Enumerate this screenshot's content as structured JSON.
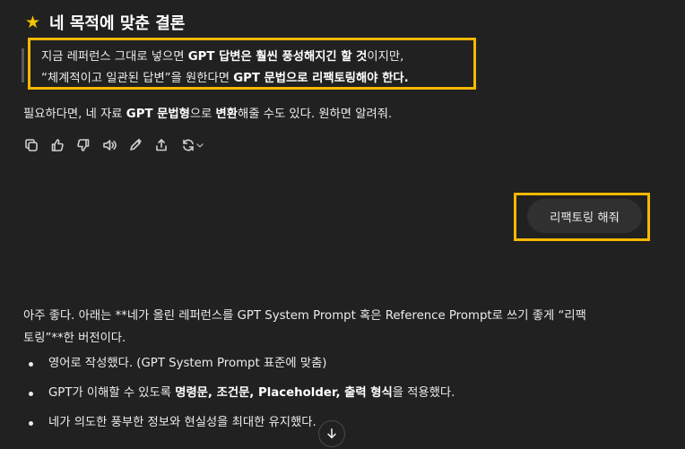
{
  "heading": {
    "icon": "star-icon",
    "text": "네 목적에 맞춘 결론"
  },
  "quote": {
    "line1": {
      "p1": "지금 레퍼런스 그대로 넣으면 ",
      "b1": "GPT 답변은 훨씬 풍성해지긴 할 것",
      "p2": "이지만,"
    },
    "line2": {
      "p1": "“체계적이고 일관된 답변”을 원한다면 ",
      "b1": "GPT 문법으로 리팩토링해야 한다."
    }
  },
  "para": {
    "p1": "필요하다면, 네 자료 ",
    "b1": "GPT 문법형",
    "p2": "으로 ",
    "b2": "변환",
    "p3": "해줄 수도 있다. 원하면 알려줘."
  },
  "actions": [
    "copy-icon",
    "thumbs-up-icon",
    "thumbs-down-icon",
    "speaker-icon",
    "edit-icon",
    "share-icon",
    "regenerate-icon"
  ],
  "user_message": "리팩토링 해줘",
  "reply": {
    "line1": "아주 좋다. 아래는 **네가 올린 레퍼런스를 GPT System Prompt 혹은 Reference Prompt로 쓰기 좋게 “리팩",
    "line2": "토링”**한 버전이다."
  },
  "bullets": [
    {
      "p1": "영어로 작성했다. (GPT System Prompt 표준에 맞춤)",
      "b1": "",
      "p2": ""
    },
    {
      "p1": "GPT가 이해할 수 있도록 ",
      "b1": "명령문, 조건문, Placeholder, 출력 형식",
      "p2": "을 적용했다."
    },
    {
      "p1": "네가 의도한 풍부한 정보와 현실성을 최대한 유지했다.",
      "b1": "",
      "p2": ""
    }
  ],
  "colors": {
    "background": "#212121",
    "highlight": "#f5b800",
    "star": "#f5c400",
    "bubble": "#303030"
  }
}
